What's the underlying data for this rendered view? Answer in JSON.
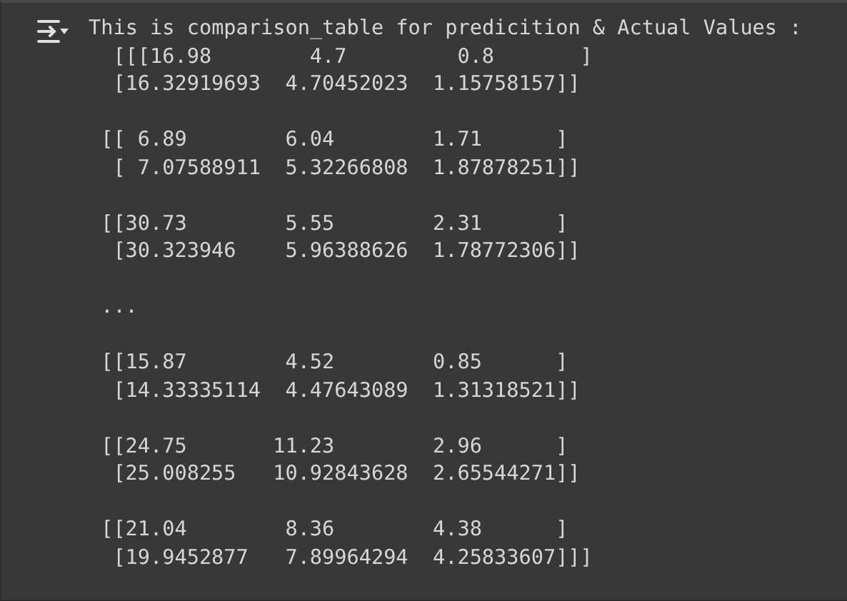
{
  "output": {
    "header": "This is comparison_table for predicition & Actual Values :",
    "blocks": [
      [
        " [[[16.98        4.7         0.8       ]",
        " [16.32919693  4.70452023  1.15758157]]"
      ],
      [
        "[[ 6.89        6.04        1.71      ]",
        " [ 7.07588911  5.32266808  1.87878251]]"
      ],
      [
        "[[30.73        5.55        2.31      ]",
        " [30.323946    5.96388626  1.78772306]]"
      ],
      [
        "..."
      ],
      [
        "[[15.87        4.52        0.85      ]",
        " [14.33335114  4.47643089  1.31318521]]"
      ],
      [
        "[[24.75       11.23        2.96      ]",
        " [25.008255   10.92843628  2.65544271]]"
      ],
      [
        "[[21.04        8.36        4.38      ]",
        " [19.9452877   7.89964294  4.25833607]]]"
      ]
    ]
  }
}
